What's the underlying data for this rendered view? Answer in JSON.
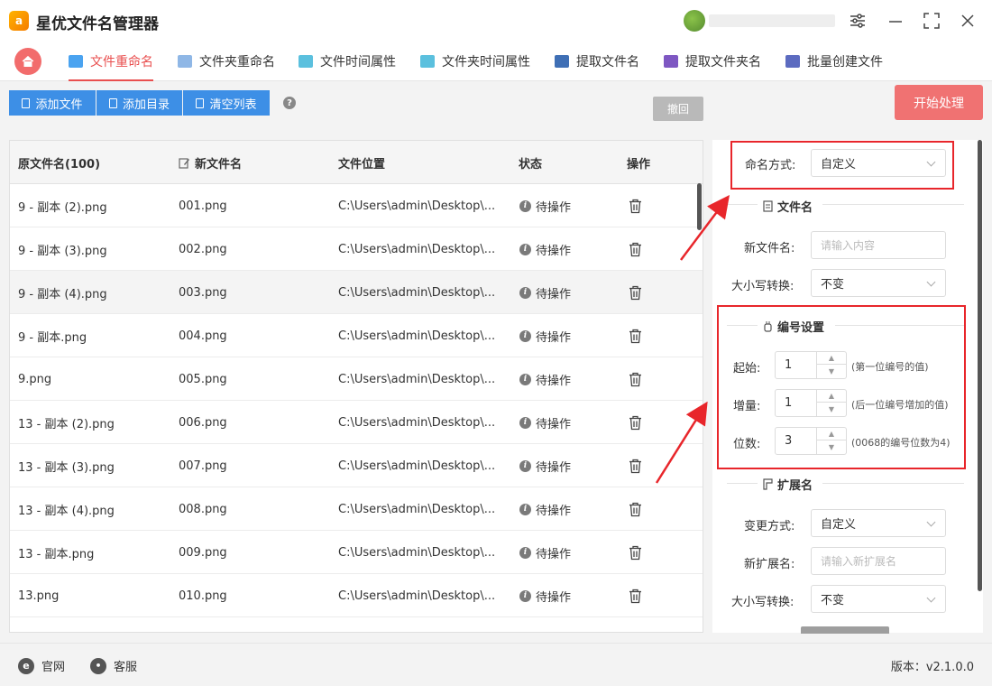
{
  "app": {
    "title": "星优文件名管理器",
    "logo_text": "a"
  },
  "tabs": [
    {
      "label": "文件重命名",
      "active": true
    },
    {
      "label": "文件夹重命名"
    },
    {
      "label": "文件时间属性"
    },
    {
      "label": "文件夹时间属性"
    },
    {
      "label": "提取文件名"
    },
    {
      "label": "提取文件夹名"
    },
    {
      "label": "批量创建文件"
    }
  ],
  "toolbar": {
    "add_file": "添加文件",
    "add_dir": "添加目录",
    "clear_list": "清空列表",
    "help": "?",
    "undo": "撤回",
    "start": "开始处理"
  },
  "table": {
    "headers": {
      "original": "原文件名(100)",
      "new": "新文件名",
      "location": "文件位置",
      "status": "状态",
      "action": "操作"
    },
    "rows": [
      {
        "original": "9 - 副本 (2).png",
        "new": "001.png",
        "location": "C:\\Users\\admin\\Desktop\\...",
        "status": "待操作"
      },
      {
        "original": "9 - 副本 (3).png",
        "new": "002.png",
        "location": "C:\\Users\\admin\\Desktop\\...",
        "status": "待操作"
      },
      {
        "original": "9 - 副本 (4).png",
        "new": "003.png",
        "location": "C:\\Users\\admin\\Desktop\\...",
        "status": "待操作"
      },
      {
        "original": "9 - 副本.png",
        "new": "004.png",
        "location": "C:\\Users\\admin\\Desktop\\...",
        "status": "待操作"
      },
      {
        "original": "9.png",
        "new": "005.png",
        "location": "C:\\Users\\admin\\Desktop\\...",
        "status": "待操作"
      },
      {
        "original": "13 - 副本 (2).png",
        "new": "006.png",
        "location": "C:\\Users\\admin\\Desktop\\...",
        "status": "待操作"
      },
      {
        "original": "13 - 副本 (3).png",
        "new": "007.png",
        "location": "C:\\Users\\admin\\Desktop\\...",
        "status": "待操作"
      },
      {
        "original": "13 - 副本 (4).png",
        "new": "008.png",
        "location": "C:\\Users\\admin\\Desktop\\...",
        "status": "待操作"
      },
      {
        "original": "13 - 副本.png",
        "new": "009.png",
        "location": "C:\\Users\\admin\\Desktop\\...",
        "status": "待操作"
      },
      {
        "original": "13.png",
        "new": "010.png",
        "location": "C:\\Users\\admin\\Desktop\\...",
        "status": "待操作"
      }
    ]
  },
  "panel": {
    "naming_mode_label": "命名方式:",
    "naming_mode_value": "自定义",
    "filename_section": "文件名",
    "new_name_label": "新文件名:",
    "new_name_placeholder": "请输入内容",
    "case_label": "大小写转换:",
    "case_value": "不变",
    "numbering_section": "编号设置",
    "start_label": "起始:",
    "start_value": "1",
    "start_hint": "(第一位编号的值)",
    "step_label": "增量:",
    "step_value": "1",
    "step_hint": "(后一位编号增加的值)",
    "digits_label": "位数:",
    "digits_value": "3",
    "digits_hint": "(0068的编号位数为4)",
    "ext_section": "扩展名",
    "change_mode_label": "变更方式:",
    "change_mode_value": "自定义",
    "new_ext_label": "新扩展名:",
    "new_ext_placeholder": "请输入新扩展名",
    "ext_case_label": "大小写转换:",
    "ext_case_value": "不变"
  },
  "footer": {
    "website": "官网",
    "support": "客服",
    "version": "版本：v2.1.0.0"
  },
  "colors": {
    "accent": "#e94f4f",
    "primary": "#3d8fe6",
    "highlight": "#e8262b"
  }
}
